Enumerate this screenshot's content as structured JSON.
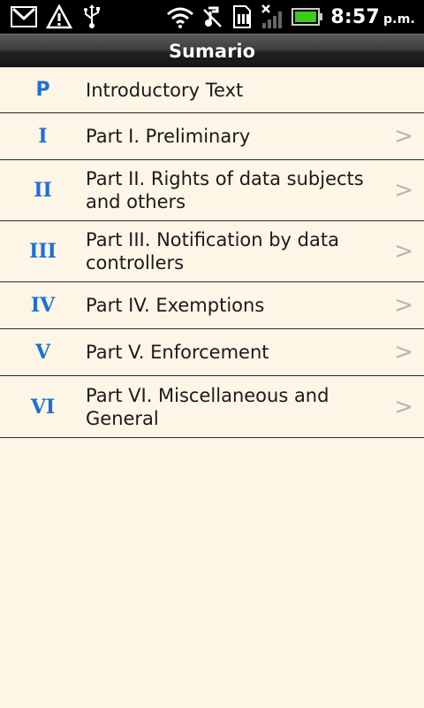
{
  "status_bar": {
    "icons_left": [
      "gmail-icon",
      "warning-icon",
      "usb-icon"
    ],
    "icons_right": [
      "wifi-icon",
      "silent-icon",
      "sim-icon",
      "no-signal-icon",
      "battery-icon"
    ],
    "time": "8:57",
    "time_suffix": "p.m."
  },
  "header": {
    "title": "Sumario"
  },
  "list": {
    "items": [
      {
        "code": "P",
        "label": "Introductory Text",
        "has_chevron": false
      },
      {
        "code": "I",
        "label": "Part I. Preliminary",
        "has_chevron": true
      },
      {
        "code": "II",
        "label": "Part II. Rights of data subjects and others",
        "has_chevron": true
      },
      {
        "code": "III",
        "label": "Part III. Notification by data controllers",
        "has_chevron": true
      },
      {
        "code": "IV",
        "label": "Part IV. Exemptions",
        "has_chevron": true
      },
      {
        "code": "V",
        "label": "Part V. Enforcement",
        "has_chevron": true
      },
      {
        "code": "VI",
        "label": "Part VI. Miscellaneous and General",
        "has_chevron": true
      }
    ],
    "chevron_glyph": ">"
  },
  "colors": {
    "background": "#fdf5e6",
    "code_color": "#1c6fd6",
    "text_color": "#1a1a1a",
    "chevron_color": "#b5b5b5"
  }
}
